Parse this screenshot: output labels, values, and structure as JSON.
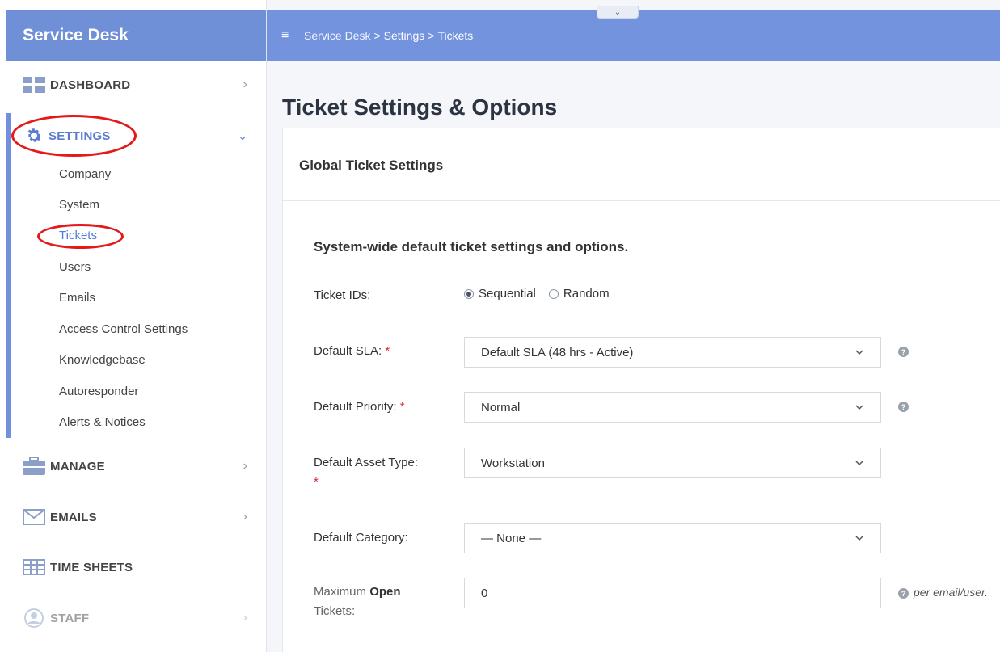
{
  "app": {
    "title": "Service Desk"
  },
  "breadcrumb": [
    "Service Desk",
    "Settings",
    "Tickets"
  ],
  "breadcrumb_separator": ">",
  "sidebar": {
    "items": [
      {
        "label": "DASHBOARD",
        "icon": "dashboard-grid-icon",
        "has_chevron": true
      },
      {
        "label": "SETTINGS",
        "icon": "gear-icon",
        "expanded": true
      },
      {
        "label": "MANAGE",
        "icon": "briefcase-icon",
        "has_chevron": true
      },
      {
        "label": "EMAILS",
        "icon": "envelope-icon",
        "has_chevron": true
      },
      {
        "label": "TIME SHEETS",
        "icon": "table-grid-icon"
      },
      {
        "label": "STAFF",
        "icon": "user-avatar-icon",
        "has_chevron": true
      }
    ],
    "settings_sub": [
      "Company",
      "System",
      "Tickets",
      "Users",
      "Emails",
      "Access Control Settings",
      "Knowledgebase",
      "Autoresponder",
      "Alerts & Notices"
    ],
    "active_sub": "Tickets"
  },
  "page": {
    "title": "Ticket Settings & Options",
    "card_title": "Global Ticket Settings",
    "section_title": "System-wide default ticket settings and options."
  },
  "form": {
    "ticket_ids": {
      "label": "Ticket IDs:",
      "options": [
        "Sequential",
        "Random"
      ],
      "selected": "Sequential"
    },
    "default_sla": {
      "label": "Default SLA:",
      "value": "Default SLA (48 hrs - Active)"
    },
    "default_priority": {
      "label": "Default Priority:",
      "value": "Normal"
    },
    "default_asset_type": {
      "label": "Default Asset Type:",
      "value": "Workstation"
    },
    "default_category": {
      "label": "Default Category:",
      "value": "— None —"
    },
    "max_open_tickets": {
      "label_prefix": "Maximum",
      "label_bold": "Open",
      "label_suffix": "Tickets:",
      "value": "0",
      "help": "per email/user."
    },
    "required_mark": "*"
  },
  "colors": {
    "brand": "#6f8fd6",
    "header": "#7393df",
    "active": "#4d7bdc",
    "required": "#d9263b",
    "annotation": "#e21a1a"
  }
}
